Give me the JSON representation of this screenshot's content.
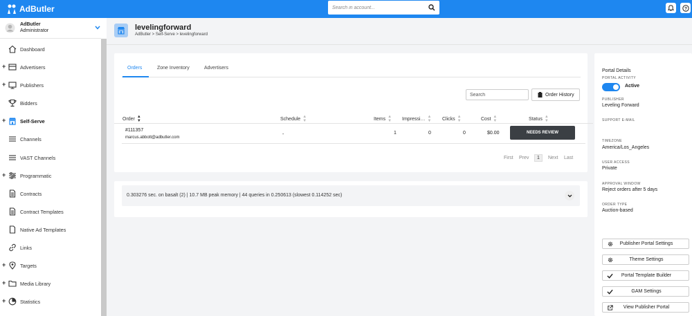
{
  "app": {
    "name": "AdButler"
  },
  "topbar": {
    "search_placeholder": "Search in account..."
  },
  "user": {
    "name": "AdButler",
    "role": "Administrator"
  },
  "sidebar": {
    "items": [
      {
        "label": "Dashboard",
        "icon": "home-icon",
        "expandable": false,
        "active": false
      },
      {
        "label": "Advertisers",
        "icon": "panel-icon",
        "expandable": true,
        "active": false
      },
      {
        "label": "Publishers",
        "icon": "monitor-icon",
        "expandable": true,
        "active": false
      },
      {
        "label": "Bidders",
        "icon": "trophy-icon",
        "expandable": false,
        "active": false
      },
      {
        "label": "Self-Serve",
        "icon": "store-icon",
        "expandable": true,
        "active": true
      },
      {
        "label": "Channels",
        "icon": "lines-icon",
        "expandable": false,
        "active": false
      },
      {
        "label": "VAST Channels",
        "icon": "lines-icon",
        "expandable": false,
        "active": false
      },
      {
        "label": "Programmatic",
        "icon": "sliders-icon",
        "expandable": true,
        "active": false
      },
      {
        "label": "Contracts",
        "icon": "document-icon",
        "expandable": false,
        "active": false
      },
      {
        "label": "Contract Templates",
        "icon": "document-icon",
        "expandable": false,
        "active": false
      },
      {
        "label": "Native Ad Templates",
        "icon": "file-icon",
        "expandable": false,
        "active": false
      },
      {
        "label": "Links",
        "icon": "link-icon",
        "expandable": false,
        "active": false
      },
      {
        "label": "Targets",
        "icon": "pin-icon",
        "expandable": true,
        "active": false
      },
      {
        "label": "Media Library",
        "icon": "folder-icon",
        "expandable": true,
        "active": false
      },
      {
        "label": "Statistics",
        "icon": "pie-icon",
        "expandable": true,
        "active": false
      }
    ]
  },
  "header": {
    "title": "levelingforward",
    "breadcrumb": "AdButler > Self-Serve > levelingforward"
  },
  "tabs": [
    "Orders",
    "Zone Inventory",
    "Advertisers"
  ],
  "orders": {
    "search_placeholder": "Search",
    "history_label": "Order History",
    "columns": [
      "Order",
      "Schedule",
      "Items",
      "Impressi…",
      "Clicks",
      "Cost",
      "Status"
    ],
    "rows": [
      {
        "id": "#111357",
        "email": "marcus.abbott@adbutler.com",
        "schedule": "-",
        "items": "1",
        "impressions": "0",
        "clicks": "0",
        "cost": "$0.00",
        "status": "NEEDS REVIEW"
      }
    ],
    "pagination": {
      "first": "First",
      "prev": "Prev",
      "current": "1",
      "next": "Next",
      "last": "Last"
    }
  },
  "debug": {
    "text": "0.303276 sec. on basalt (2) | 10.7 MB peak memory | 44 queries in 0.250613 (slowest 0.114252 sec)"
  },
  "details": {
    "title": "Portal Details",
    "portal_activity_label": "PORTAL ACTIVITY",
    "portal_activity_value": "Active",
    "publisher_label": "PUBLISHER",
    "publisher_value": "Leveling Forward",
    "support_email_label": "SUPPORT E-MAIL",
    "timezone_label": "TIMEZONE",
    "timezone_value": "America/Los_Angeles",
    "user_access_label": "USER ACCESS",
    "user_access_value": "Private",
    "approval_label": "APPROVAL WINDOW",
    "approval_value": "Reject orders after 5 days",
    "order_type_label": "ORDER TYPE",
    "order_type_value": "Auction-based"
  },
  "actions": [
    {
      "label": "Publisher Portal Settings",
      "icon": "gear-icon"
    },
    {
      "label": "Theme Settings",
      "icon": "gear-icon"
    },
    {
      "label": "Portal Template Builder",
      "icon": "check-icon"
    },
    {
      "label": "GAM Settings",
      "icon": "check-icon"
    },
    {
      "label": "View Publisher Portal",
      "icon": "external-link-icon"
    }
  ],
  "colors": {
    "primary": "#1e87f0",
    "status_button": "#3b3f44",
    "background": "#f3f4f6"
  }
}
